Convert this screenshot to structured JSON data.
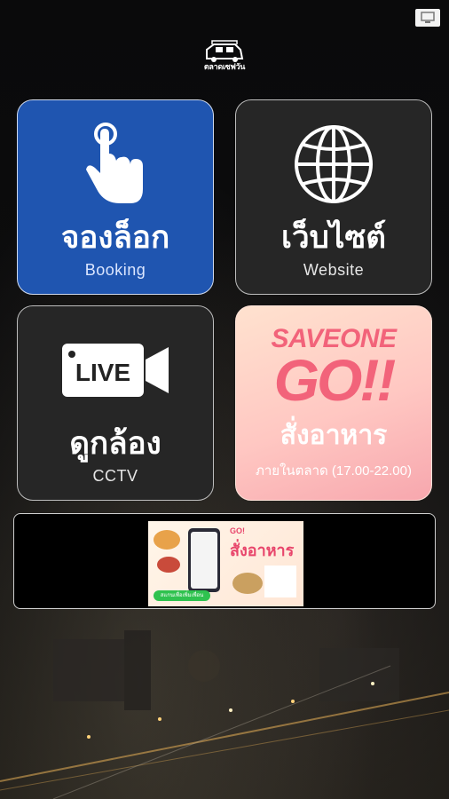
{
  "app": {
    "logo_text": "ตลาดเซฟวัน"
  },
  "tiles": {
    "booking": {
      "title_th": "จองล็อก",
      "title_en": "Booking",
      "icon": "tap-hand-icon"
    },
    "website": {
      "title_th": "เว็บไซต์",
      "title_en": "Website",
      "icon": "globe-icon"
    },
    "cctv": {
      "title_th": "ดูกล้อง",
      "title_en": "CCTV",
      "icon": "live-camera-icon",
      "badge": "LIVE"
    },
    "order": {
      "brand_top": "SAVEONE",
      "brand_bottom": "GO!!",
      "title_th": "สั่งอาหาร",
      "subtitle_th": "ภายในตลาด (17.00-22.00)"
    }
  },
  "banner": {
    "ad_brand": "GO!",
    "ad_headline": "สั่งอาหาร",
    "ad_line_button": "สแกนเพื่อเพิ่มเพื่อน"
  },
  "colors": {
    "booking_tile": "#1f55b0",
    "dark_tile": "#262626",
    "saveone_pink": "#f2637a"
  }
}
